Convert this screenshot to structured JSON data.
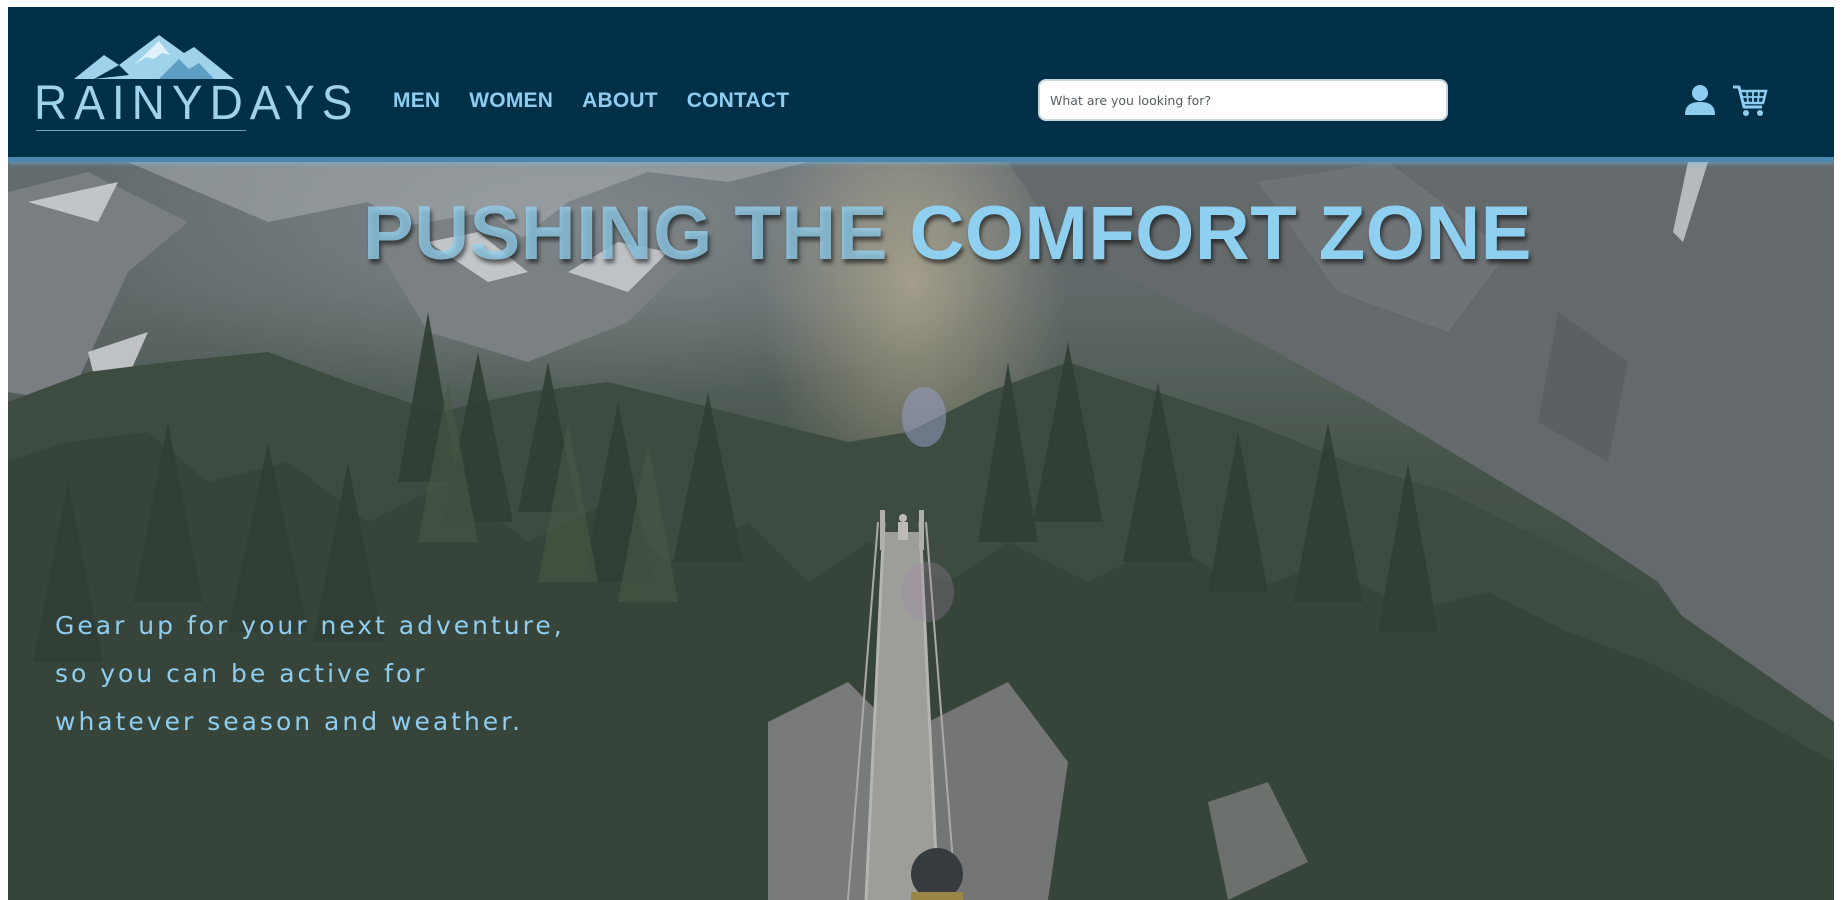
{
  "brand": {
    "name": "RAINYDAYS",
    "logo_icon": "mountain-icon"
  },
  "nav": {
    "items": [
      {
        "label": "MEN"
      },
      {
        "label": "WOMEN"
      },
      {
        "label": "ABOUT"
      },
      {
        "label": "CONTACT"
      }
    ]
  },
  "search": {
    "placeholder": "What are you looking for?",
    "value": ""
  },
  "header_icons": {
    "account": "user-icon",
    "cart": "cart-icon"
  },
  "hero": {
    "headline_light": "PUSHING THE ",
    "headline_strong": "COMFORT ZONE",
    "tagline_lines": [
      "Gear up for your next adventure,",
      "so you can be active for",
      "whatever season and weather."
    ],
    "image": "mountain-suspension-bridge-photo"
  },
  "colors": {
    "header_bg": "#002f48",
    "accent": "#8fcdf0"
  }
}
